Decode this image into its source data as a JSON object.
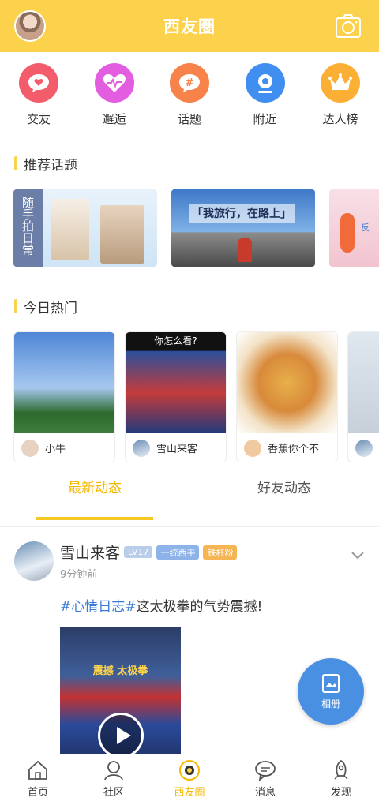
{
  "header": {
    "title": "西友圈"
  },
  "categories": [
    {
      "label": "交友",
      "color": "#f25c6b",
      "icon": "chat-heart-icon"
    },
    {
      "label": "邂逅",
      "color": "#e35de0",
      "icon": "heartbeat-icon"
    },
    {
      "label": "话题",
      "color": "#f7824a",
      "icon": "hashtag-icon"
    },
    {
      "label": "附近",
      "color": "#3f8ef0",
      "icon": "location-icon"
    },
    {
      "label": "达人榜",
      "color": "#fbb035",
      "icon": "crown-icon"
    }
  ],
  "recommend": {
    "title": "推荐话题",
    "topics": [
      {
        "text": "随手拍日常"
      },
      {
        "text": "「我旅行，在路上」"
      },
      {
        "text": "反"
      }
    ]
  },
  "hot": {
    "title": "今日热门",
    "items": [
      {
        "user": "小牛",
        "caption": ""
      },
      {
        "user": "雪山来客",
        "caption": "你怎么看?"
      },
      {
        "user": "香蕉你个不",
        "caption": ""
      },
      {
        "user": "",
        "caption": ""
      }
    ]
  },
  "tabs": [
    {
      "label": "最新动态"
    },
    {
      "label": "好友动态"
    }
  ],
  "post": {
    "name": "雪山来客",
    "level": "LV17",
    "badge1": "一统西平",
    "badge2": "铁杆粉",
    "time": "9分钟前",
    "tag": "#心情日志#",
    "text": "这太极拳的气势震撼!",
    "video_caption": "震撼 太极拳"
  },
  "fab": {
    "label": "相册"
  },
  "nav": [
    {
      "label": "首页"
    },
    {
      "label": "社区"
    },
    {
      "label": "西友圈"
    },
    {
      "label": "消息"
    },
    {
      "label": "发现"
    }
  ]
}
